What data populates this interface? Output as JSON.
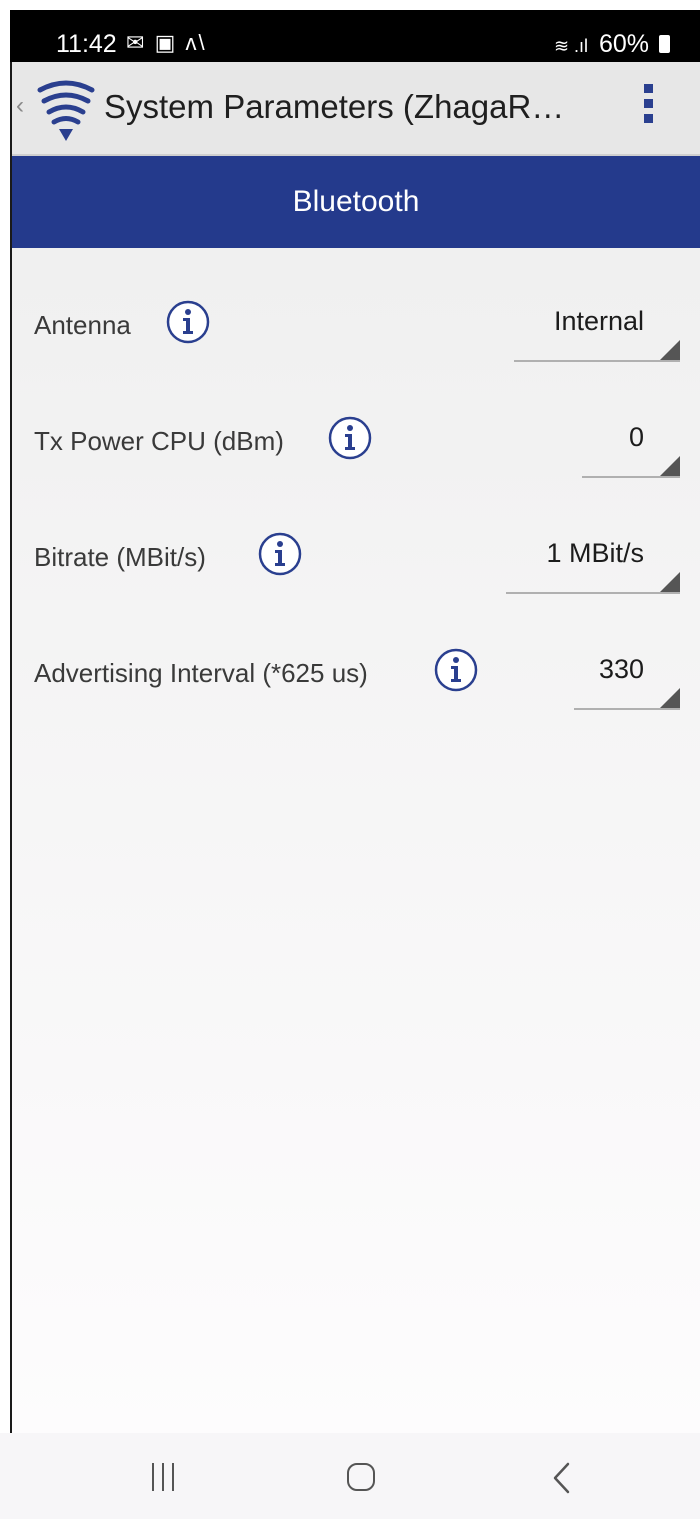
{
  "status_bar": {
    "time": "11:42",
    "notification_icons": [
      "message-icon",
      "gallery-icon",
      "app-icon"
    ],
    "battery": "60%"
  },
  "app_bar": {
    "title": "System Parameters (ZhagaR…",
    "logo_icon": "signal-pyramid-logo",
    "overflow_icon": "more-vert-icon"
  },
  "section": {
    "title": "Bluetooth"
  },
  "settings": [
    {
      "label": "Antenna",
      "value": "Internal"
    },
    {
      "label": "Tx Power CPU (dBm)",
      "value": "0"
    },
    {
      "label": "Bitrate (MBit/s)",
      "value": "1 MBit/s"
    },
    {
      "label": "Advertising Interval (*625 us)",
      "value": "330"
    }
  ],
  "colors": {
    "header_blue": "#243a8c",
    "icon_blue": "#2a3f8f",
    "app_bar_gray": "#e7e7e7"
  }
}
